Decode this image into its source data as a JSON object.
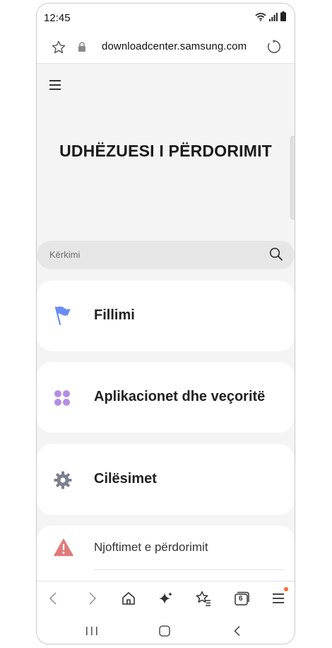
{
  "status_bar": {
    "time": "12:45"
  },
  "browser": {
    "url": "downloadcenter.samsung.com",
    "tab_count": "6"
  },
  "page": {
    "title": "UDHËZUESI I PËRDORIMIT",
    "search_placeholder": "Kërkimi",
    "menu_items": [
      {
        "label": "Fillimi",
        "icon": "flag-icon",
        "color": "#6a8df5"
      },
      {
        "label": "Aplikacionet dhe veçoritë",
        "icon": "apps-dots-icon",
        "color": "#b38de8"
      },
      {
        "label": "Cilësimet",
        "icon": "gear-icon",
        "color": "#7b7f8e"
      },
      {
        "label": "Njoftimet e përdorimit",
        "icon": "warning-icon",
        "color": "#e07a7a"
      }
    ]
  },
  "colors": {
    "notification_dot": "#ff6a2f",
    "background": "#f4f4f4"
  }
}
